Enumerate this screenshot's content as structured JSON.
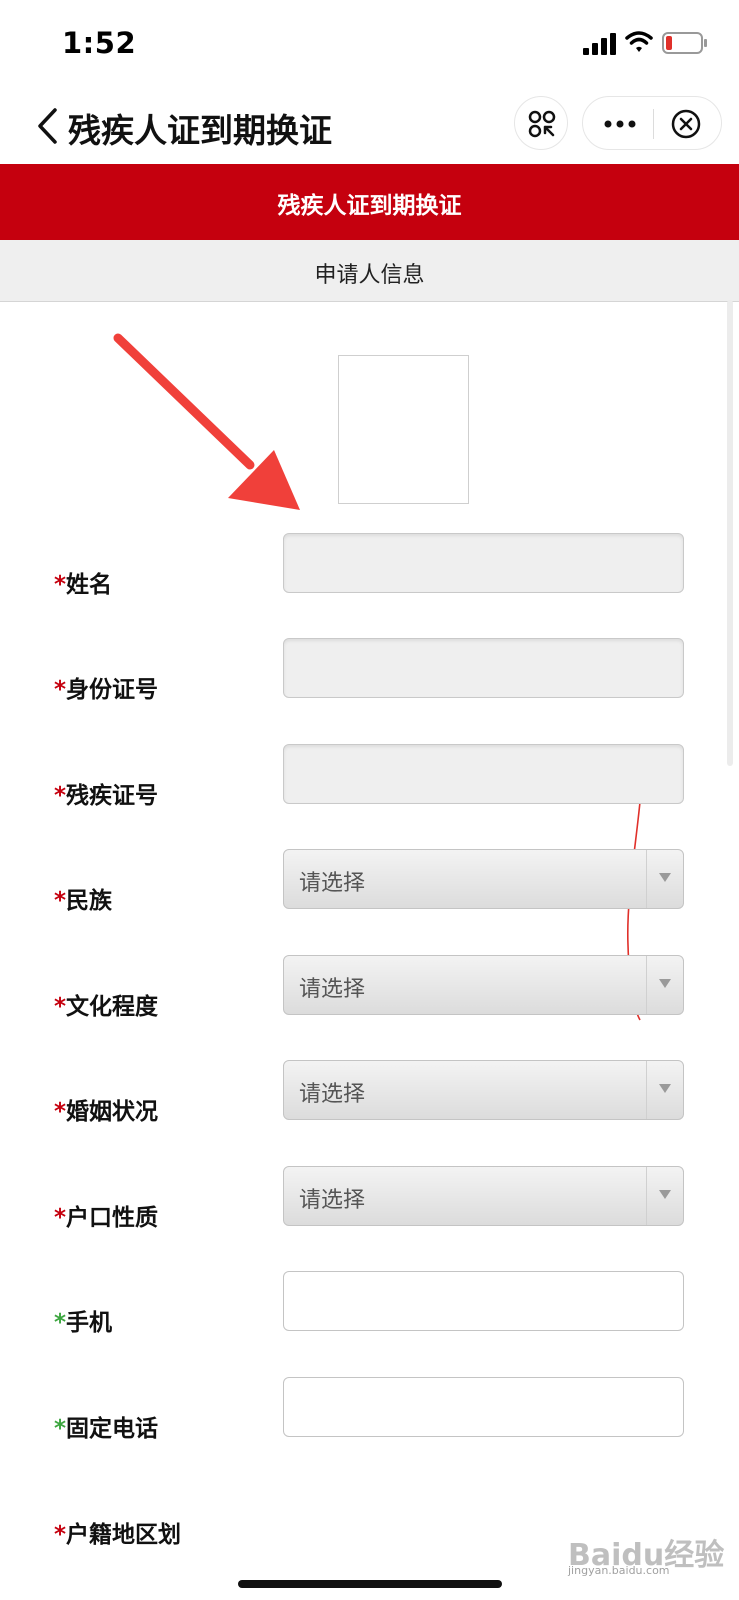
{
  "status_bar": {
    "time": "1:52"
  },
  "nav": {
    "title": "残疾人证到期换证"
  },
  "banner": {
    "title": "残疾人证到期换证"
  },
  "section": {
    "title": "申请人信息"
  },
  "form": {
    "fields": [
      {
        "label": "姓名",
        "marker": "*",
        "type": "text-disabled"
      },
      {
        "label": "身份证号",
        "marker": "*",
        "type": "text-disabled"
      },
      {
        "label": "残疾证号",
        "marker": "*",
        "type": "text-disabled"
      },
      {
        "label": "民族",
        "marker": "*",
        "type": "select",
        "value": "请选择"
      },
      {
        "label": "文化程度",
        "marker": "*",
        "type": "select",
        "value": "请选择"
      },
      {
        "label": "婚姻状况",
        "marker": "*",
        "type": "select",
        "value": "请选择"
      },
      {
        "label": "户口性质",
        "marker": "*",
        "type": "select",
        "value": "请选择"
      },
      {
        "label": "手机",
        "marker": "*",
        "type": "text"
      },
      {
        "label": "固定电话",
        "marker": "*",
        "type": "text"
      },
      {
        "label": "户籍地区划",
        "marker": "*",
        "type": "region"
      }
    ]
  },
  "watermark": {
    "main": "Baidu经验",
    "sub": "jingyan.baidu.com"
  },
  "colors": {
    "brand_red": "#c5000e",
    "optional_green": "#3da640"
  }
}
